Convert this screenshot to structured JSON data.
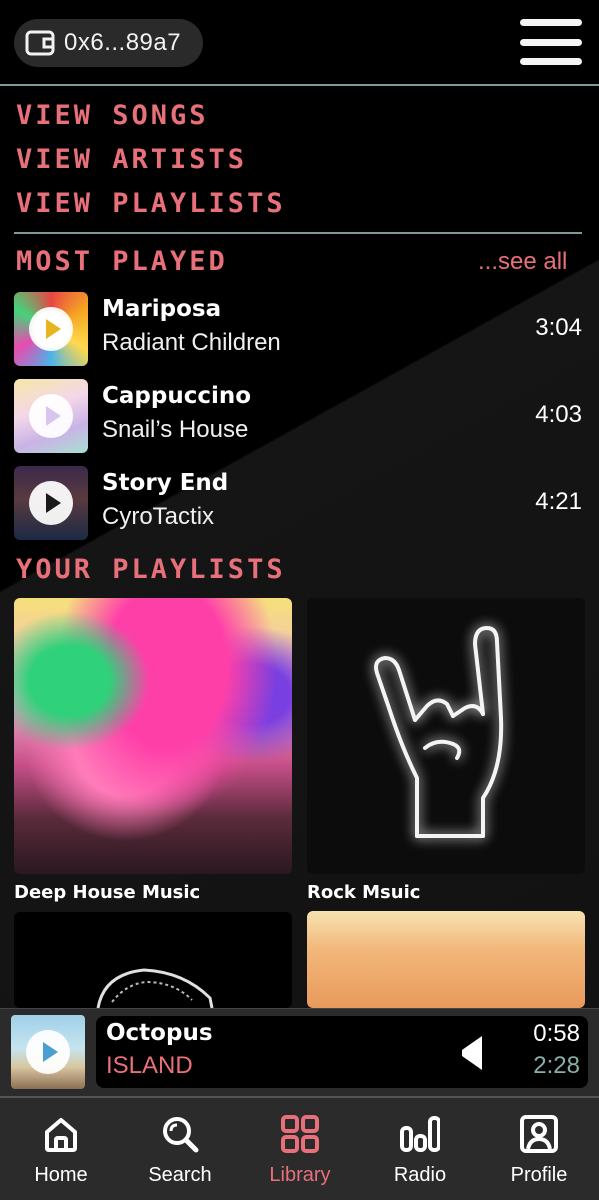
{
  "header": {
    "wallet_address": "0x6...89a7",
    "wallet_icon": "wallet-icon",
    "menu_icon": "hamburger-menu-icon"
  },
  "view_links": [
    {
      "label": "VIEW SONGS"
    },
    {
      "label": "VIEW ARTISTS"
    },
    {
      "label": "VIEW PLAYLISTS"
    }
  ],
  "most_played": {
    "title": "MOST PLAYED",
    "see_all": "...see all",
    "tracks": [
      {
        "title": "Mariposa",
        "artist": "Radiant Children",
        "duration": "3:04"
      },
      {
        "title": "Cappuccino",
        "artist": "Snail’s House",
        "duration": "4:03"
      },
      {
        "title": "Story End",
        "artist": "CyroTactix",
        "duration": "4:21"
      }
    ]
  },
  "playlists": {
    "title": "YOUR PLAYLISTS",
    "items": [
      {
        "name": "Deep House Music"
      },
      {
        "name": "Rock Msuic"
      }
    ]
  },
  "now_playing": {
    "title": "Octopus",
    "artist": "ISLAND",
    "elapsed": "0:58",
    "total": "2:28"
  },
  "nav": [
    {
      "label": "Home",
      "icon": "home-icon"
    },
    {
      "label": "Search",
      "icon": "search-icon"
    },
    {
      "label": "Library",
      "icon": "library-icon",
      "active": true
    },
    {
      "label": "Radio",
      "icon": "radio-icon"
    },
    {
      "label": "Profile",
      "icon": "profile-icon"
    }
  ],
  "colors": {
    "accent": "#e8707a",
    "divider": "#7e9a98",
    "bar_bg": "#2b2b2b",
    "secondary_time": "#8aaea9"
  }
}
